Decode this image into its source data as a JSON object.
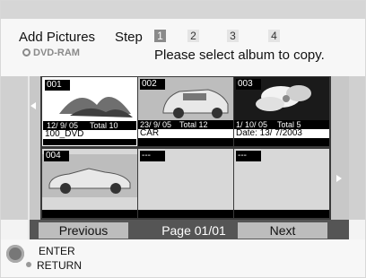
{
  "header": {
    "title": "Add Pictures",
    "disc": "DVD-RAM",
    "step_label": "Step",
    "steps": [
      "1",
      "2",
      "3",
      "4"
    ],
    "instruction": "Please select album to copy."
  },
  "grid": {
    "tiles": [
      {
        "number": "001",
        "date": "12/ 9/ 05",
        "total": "Total 10",
        "name": "100_DVD"
      },
      {
        "number": "002",
        "date": "23/ 9/ 05",
        "total": "Total 12",
        "name": "CAR"
      },
      {
        "number": "003",
        "date": "1/ 10/ 05",
        "total": "Total 5",
        "name": "Date: 13/ 7/2003"
      },
      {
        "number": "004",
        "date": "",
        "total": "",
        "name": ""
      },
      {
        "number": "---",
        "date": "",
        "total": "",
        "name": ""
      },
      {
        "number": "---",
        "date": "",
        "total": "",
        "name": ""
      }
    ]
  },
  "nav": {
    "previous": "Previous",
    "page": "Page 01/01",
    "next": "Next"
  },
  "footer": {
    "enter": "ENTER",
    "return": "RETURN"
  }
}
